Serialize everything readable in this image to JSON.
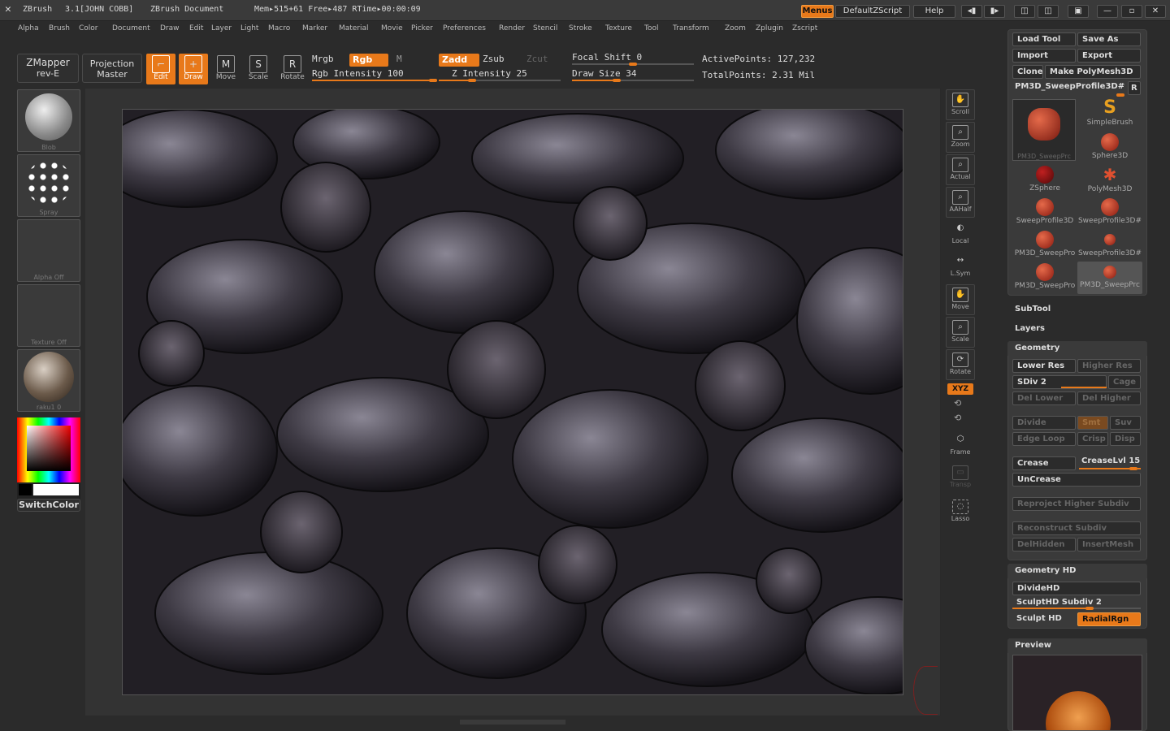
{
  "titlebar": {
    "app": "ZBrush",
    "version": "3.1[JOHN COBB]",
    "doc": "ZBrush Document",
    "mem": "Mem▸515+61  Free▸487  RTime▸00:00:09",
    "menus_btn": "Menus",
    "script_btn": "DefaultZScript",
    "help_btn": "Help"
  },
  "menubar": [
    "Alpha",
    "Brush",
    "Color",
    "Document",
    "Draw",
    "Edit",
    "Layer",
    "Light",
    "Macro",
    "Marker",
    "Material",
    "Movie",
    "Picker",
    "Preferences",
    "Render",
    "Stencil",
    "Stroke",
    "Texture",
    "Tool",
    "Transform",
    "Zoom",
    "Zplugin",
    "Zscript"
  ],
  "toolbar": {
    "zmapper": "ZMapper",
    "zmapper_sub": "rev-E",
    "projection": "Projection",
    "projection_sub": "Master",
    "edit": "Edit",
    "draw": "Draw",
    "move": "Move",
    "scale": "Scale",
    "rotate": "Rotate",
    "mrgb": "Mrgb",
    "rgb": "Rgb",
    "m": "M",
    "rgb_intensity": "Rgb Intensity 100",
    "zadd": "Zadd",
    "zsub": "Zsub",
    "zcut": "Zcut",
    "z_intensity": "Z Intensity 25",
    "focal_shift": "Focal Shift 0",
    "draw_size": "Draw Size 34",
    "active_points": "ActivePoints: 127,232",
    "total_points": "TotalPoints: 2.31 Mil"
  },
  "left": {
    "blob": "Blob",
    "spray": "Spray",
    "alpha": "Alpha Off",
    "texture": "Texture Off",
    "material": "raku1 0",
    "switch": "SwitchColor"
  },
  "shelf": [
    "Scroll",
    "Zoom",
    "Actual",
    "AAHalf",
    "Local",
    "L.Sym",
    "Move",
    "Scale",
    "Rotate",
    "Frame",
    "Transp",
    "Lasso"
  ],
  "shelf_xyz": "XYZ",
  "tool": {
    "load": "Load Tool",
    "save": "Save As",
    "import": "Import",
    "export": "Export",
    "clone": "Clone",
    "make": "Make PolyMesh3D",
    "current": "PM3D_SweepProfile3D#",
    "r": "R",
    "thumbs": [
      {
        "label": "PM3D_SweepPrc"
      },
      {
        "label": "SimpleBrush"
      },
      {
        "label": "Sphere3D"
      },
      {
        "label": "ZSphere"
      },
      {
        "label": "PolyMesh3D"
      },
      {
        "label": "SweepProfile3D"
      },
      {
        "label": "SweepProfile3D#"
      },
      {
        "label": "PM3D_SweepPro"
      },
      {
        "label": "SweepProfile3D#"
      },
      {
        "label": "PM3D_SweepPro"
      },
      {
        "label": "PM3D_SweepPrc"
      }
    ],
    "subtool": "SubTool",
    "layers": "Layers",
    "geometry": "Geometry",
    "lower_res": "Lower Res",
    "higher_res": "Higher Res",
    "sdiv": "SDiv 2",
    "cage": "Cage",
    "del_lower": "Del Lower",
    "del_higher": "Del Higher",
    "divide": "Divide",
    "smt": "Smt",
    "suv": "Suv",
    "edge_loop": "Edge Loop",
    "crisp": "Crisp",
    "disp": "Disp",
    "crease": "Crease",
    "creaselvl": "CreaseLvl 15",
    "uncrease": "UnCrease",
    "reproject": "Reproject Higher Subdiv",
    "reconstruct": "Reconstruct Subdiv",
    "delhidden": "DelHidden",
    "insertmesh": "InsertMesh",
    "geometry_hd": "Geometry HD",
    "dividehd": "DivideHD",
    "sculpthd_subdiv": "SculptHD Subdiv 2",
    "sculpt_hd": "Sculpt HD",
    "radialrgn": "RadialRgn",
    "preview": "Preview"
  },
  "colors": {
    "accent": "#e8791a"
  }
}
